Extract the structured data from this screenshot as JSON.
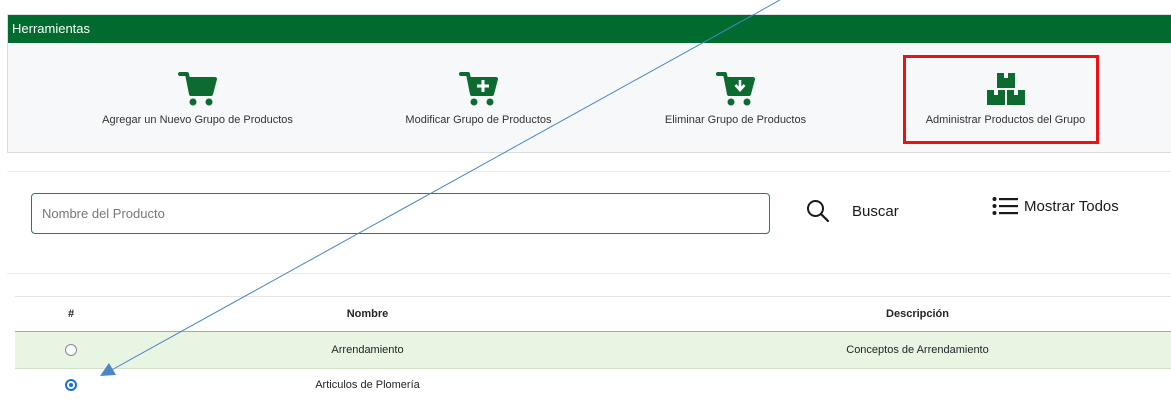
{
  "toolbar": {
    "title": "Herramientas",
    "items": [
      {
        "label": "Agregar un Nuevo Grupo de Productos",
        "icon": "cart-icon"
      },
      {
        "label": "Modificar Grupo de Productos",
        "icon": "cart-plus-icon"
      },
      {
        "label": "Eliminar Grupo de Productos",
        "icon": "cart-download-icon"
      },
      {
        "label": "Administrar Productos del Grupo",
        "icon": "boxes-icon"
      }
    ]
  },
  "search": {
    "placeholder": "Nombre del Producto",
    "value": "",
    "search_label": "Buscar",
    "show_all_label": "Mostrar Todos"
  },
  "table": {
    "headers": [
      "#",
      "Nombre",
      "Descripción"
    ],
    "rows": [
      {
        "name": "Arrendamiento",
        "description": "Conceptos de Arrendamiento",
        "selected": false
      },
      {
        "name": "Articulos de Plomería",
        "description": "",
        "selected": true
      }
    ]
  },
  "colors": {
    "header_green": "#006b2e",
    "icon_green": "#0d6b2f",
    "highlight_red": "#ee1111",
    "annotation_blue": "#4a86c8",
    "radio_blue": "#1a6fe0"
  }
}
